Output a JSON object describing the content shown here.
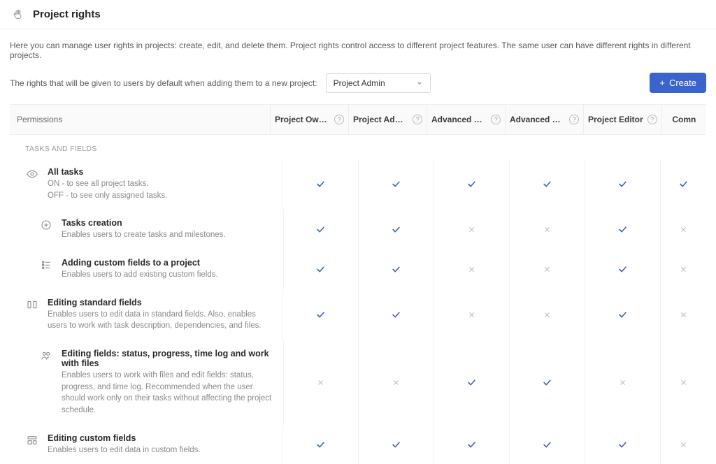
{
  "header": {
    "title": "Project rights"
  },
  "intro": "Here you can manage user rights in projects: create, edit, and delete them. Project rights control access to different project features. The same user can have different rights in different projects.",
  "toolbar": {
    "defaultRightsLabel": "The rights that will be given to users by default when adding them to a new project:",
    "dropdownValue": "Project Admin",
    "createLabel": "Create"
  },
  "columns": [
    "Permissions",
    "Project Owner",
    "Project Admin",
    "Advanced M…",
    "Advanced M…",
    "Project Editor",
    "Comn"
  ],
  "sectionLabel": "TASKS AND FIELDS",
  "rows": [
    {
      "id": "all-tasks",
      "nested": false,
      "icon": "eye",
      "title": "All tasks",
      "desc": "ON - to see all project tasks.\nOFF - to see only assigned tasks.",
      "vals": [
        "check",
        "check",
        "check",
        "check",
        "check",
        "check"
      ]
    },
    {
      "id": "tasks-creation",
      "nested": true,
      "icon": "plus-circle",
      "title": "Tasks creation",
      "desc": "Enables users to create tasks and milestones.",
      "vals": [
        "check",
        "check",
        "cross",
        "cross",
        "check",
        "cross"
      ]
    },
    {
      "id": "adding-custom-fields",
      "nested": true,
      "icon": "list",
      "title": "Adding custom fields to a project",
      "desc": "Enables users to add existing custom fields.",
      "vals": [
        "check",
        "check",
        "cross",
        "cross",
        "check",
        "cross"
      ]
    },
    {
      "id": "editing-standard-fields",
      "nested": false,
      "icon": "columns",
      "title": "Editing standard fields",
      "desc": "Enables users to edit data in standard fields. Also, enables users to work with task description, dependencies, and files.",
      "vals": [
        "check",
        "check",
        "cross",
        "cross",
        "check",
        "cross"
      ]
    },
    {
      "id": "editing-fields-status",
      "nested": true,
      "icon": "user-progress",
      "title": "Editing fields: status, progress, time log and work with files",
      "desc": "Enables users to work with files and edit fields: status, progress, and time log. Recommended when the user should work only on their tasks without affecting the project schedule.",
      "vals": [
        "cross",
        "cross",
        "check",
        "check",
        "cross",
        "cross"
      ]
    },
    {
      "id": "editing-custom-fields",
      "nested": false,
      "icon": "layout",
      "title": "Editing custom fields",
      "desc": "Enables users to edit data in custom fields.",
      "vals": [
        "check",
        "check",
        "check",
        "check",
        "check",
        "cross"
      ]
    }
  ]
}
